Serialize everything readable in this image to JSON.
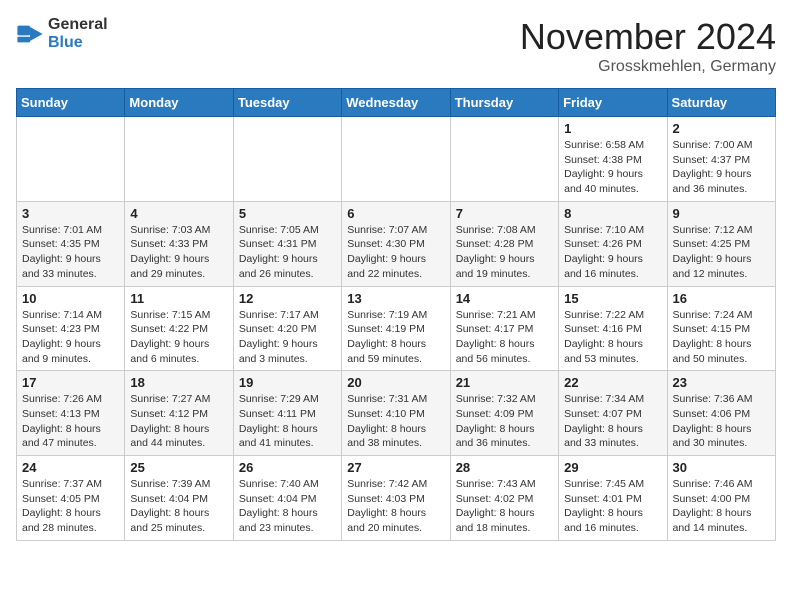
{
  "logo": {
    "text_general": "General",
    "text_blue": "Blue"
  },
  "header": {
    "month_year": "November 2024",
    "location": "Grosskmehlen, Germany"
  },
  "days_of_week": [
    "Sunday",
    "Monday",
    "Tuesday",
    "Wednesday",
    "Thursday",
    "Friday",
    "Saturday"
  ],
  "weeks": [
    [
      {
        "day": "",
        "info": ""
      },
      {
        "day": "",
        "info": ""
      },
      {
        "day": "",
        "info": ""
      },
      {
        "day": "",
        "info": ""
      },
      {
        "day": "",
        "info": ""
      },
      {
        "day": "1",
        "info": "Sunrise: 6:58 AM\nSunset: 4:38 PM\nDaylight: 9 hours and 40 minutes."
      },
      {
        "day": "2",
        "info": "Sunrise: 7:00 AM\nSunset: 4:37 PM\nDaylight: 9 hours and 36 minutes."
      }
    ],
    [
      {
        "day": "3",
        "info": "Sunrise: 7:01 AM\nSunset: 4:35 PM\nDaylight: 9 hours and 33 minutes."
      },
      {
        "day": "4",
        "info": "Sunrise: 7:03 AM\nSunset: 4:33 PM\nDaylight: 9 hours and 29 minutes."
      },
      {
        "day": "5",
        "info": "Sunrise: 7:05 AM\nSunset: 4:31 PM\nDaylight: 9 hours and 26 minutes."
      },
      {
        "day": "6",
        "info": "Sunrise: 7:07 AM\nSunset: 4:30 PM\nDaylight: 9 hours and 22 minutes."
      },
      {
        "day": "7",
        "info": "Sunrise: 7:08 AM\nSunset: 4:28 PM\nDaylight: 9 hours and 19 minutes."
      },
      {
        "day": "8",
        "info": "Sunrise: 7:10 AM\nSunset: 4:26 PM\nDaylight: 9 hours and 16 minutes."
      },
      {
        "day": "9",
        "info": "Sunrise: 7:12 AM\nSunset: 4:25 PM\nDaylight: 9 hours and 12 minutes."
      }
    ],
    [
      {
        "day": "10",
        "info": "Sunrise: 7:14 AM\nSunset: 4:23 PM\nDaylight: 9 hours and 9 minutes."
      },
      {
        "day": "11",
        "info": "Sunrise: 7:15 AM\nSunset: 4:22 PM\nDaylight: 9 hours and 6 minutes."
      },
      {
        "day": "12",
        "info": "Sunrise: 7:17 AM\nSunset: 4:20 PM\nDaylight: 9 hours and 3 minutes."
      },
      {
        "day": "13",
        "info": "Sunrise: 7:19 AM\nSunset: 4:19 PM\nDaylight: 8 hours and 59 minutes."
      },
      {
        "day": "14",
        "info": "Sunrise: 7:21 AM\nSunset: 4:17 PM\nDaylight: 8 hours and 56 minutes."
      },
      {
        "day": "15",
        "info": "Sunrise: 7:22 AM\nSunset: 4:16 PM\nDaylight: 8 hours and 53 minutes."
      },
      {
        "day": "16",
        "info": "Sunrise: 7:24 AM\nSunset: 4:15 PM\nDaylight: 8 hours and 50 minutes."
      }
    ],
    [
      {
        "day": "17",
        "info": "Sunrise: 7:26 AM\nSunset: 4:13 PM\nDaylight: 8 hours and 47 minutes."
      },
      {
        "day": "18",
        "info": "Sunrise: 7:27 AM\nSunset: 4:12 PM\nDaylight: 8 hours and 44 minutes."
      },
      {
        "day": "19",
        "info": "Sunrise: 7:29 AM\nSunset: 4:11 PM\nDaylight: 8 hours and 41 minutes."
      },
      {
        "day": "20",
        "info": "Sunrise: 7:31 AM\nSunset: 4:10 PM\nDaylight: 8 hours and 38 minutes."
      },
      {
        "day": "21",
        "info": "Sunrise: 7:32 AM\nSunset: 4:09 PM\nDaylight: 8 hours and 36 minutes."
      },
      {
        "day": "22",
        "info": "Sunrise: 7:34 AM\nSunset: 4:07 PM\nDaylight: 8 hours and 33 minutes."
      },
      {
        "day": "23",
        "info": "Sunrise: 7:36 AM\nSunset: 4:06 PM\nDaylight: 8 hours and 30 minutes."
      }
    ],
    [
      {
        "day": "24",
        "info": "Sunrise: 7:37 AM\nSunset: 4:05 PM\nDaylight: 8 hours and 28 minutes."
      },
      {
        "day": "25",
        "info": "Sunrise: 7:39 AM\nSunset: 4:04 PM\nDaylight: 8 hours and 25 minutes."
      },
      {
        "day": "26",
        "info": "Sunrise: 7:40 AM\nSunset: 4:04 PM\nDaylight: 8 hours and 23 minutes."
      },
      {
        "day": "27",
        "info": "Sunrise: 7:42 AM\nSunset: 4:03 PM\nDaylight: 8 hours and 20 minutes."
      },
      {
        "day": "28",
        "info": "Sunrise: 7:43 AM\nSunset: 4:02 PM\nDaylight: 8 hours and 18 minutes."
      },
      {
        "day": "29",
        "info": "Sunrise: 7:45 AM\nSunset: 4:01 PM\nDaylight: 8 hours and 16 minutes."
      },
      {
        "day": "30",
        "info": "Sunrise: 7:46 AM\nSunset: 4:00 PM\nDaylight: 8 hours and 14 minutes."
      }
    ]
  ]
}
